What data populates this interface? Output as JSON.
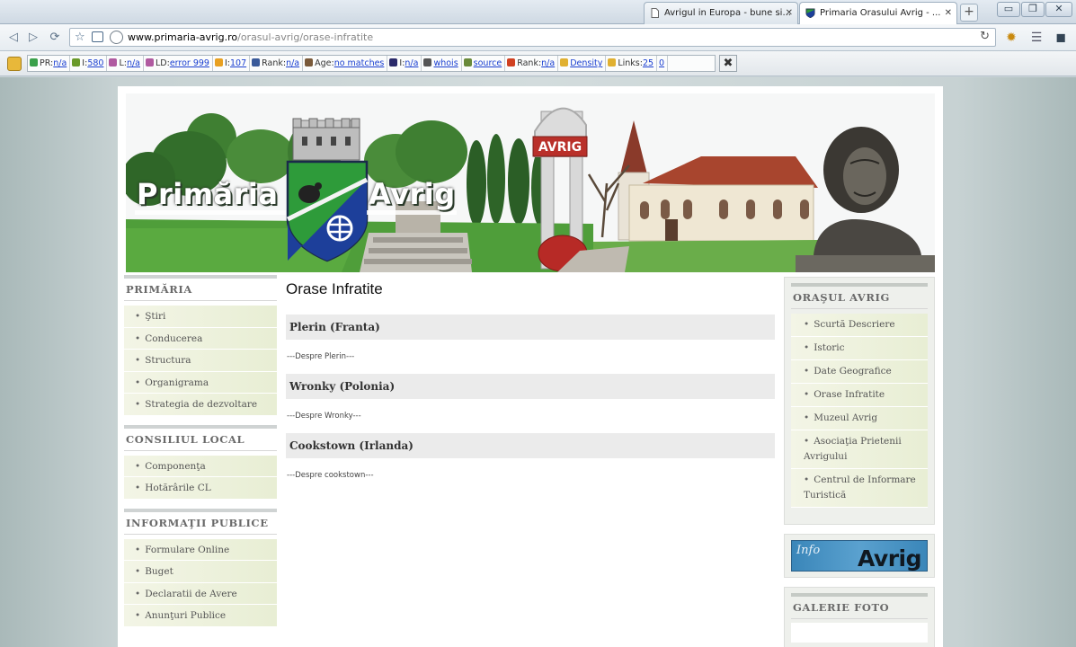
{
  "browser": {
    "tabs": [
      {
        "title": "Avrigul in Europa - bune si...",
        "active": false
      },
      {
        "title": "Primaria Orasului Avrig - ...",
        "active": true
      }
    ],
    "url_domain": "www.primaria-avrig.ro",
    "url_path": "/orasul-avrig/orase-infratite"
  },
  "seo_toolbar": {
    "items": [
      {
        "label": "PR:",
        "value": "n/a",
        "icon_color": "#3aa04a"
      },
      {
        "label": "I:",
        "value": "580",
        "icon_color": "#6a9a2a"
      },
      {
        "label": "L:",
        "value": "n/a",
        "icon_color": "#b05aa0"
      },
      {
        "label": "LD:",
        "value": "error 999",
        "icon_color": "#b05aa0"
      },
      {
        "label": "I:",
        "value": "107",
        "icon_color": "#e8a020"
      },
      {
        "label": "Rank:",
        "value": "n/a",
        "icon_color": "#3a5a9a"
      },
      {
        "label": "Age:",
        "value": "no matches",
        "icon_color": "#7a5a3a"
      },
      {
        "label": "I:",
        "value": "n/a",
        "icon_color": "#2a2a6a"
      },
      {
        "label": "",
        "value": "whois",
        "icon_color": "#555555"
      },
      {
        "label": "",
        "value": "source",
        "icon_color": "#6a8a3a"
      },
      {
        "label": "Rank:",
        "value": "n/a",
        "icon_color": "#d04020"
      },
      {
        "label": "",
        "value": "Density",
        "icon_color": "#e0b030"
      },
      {
        "label": "Links:",
        "value": "25",
        "icon_color": "#e0b030"
      },
      {
        "label": "",
        "value": "0",
        "icon_color": ""
      }
    ]
  },
  "banner": {
    "title_left": "Primăria",
    "title_right": "Avrig",
    "sign_text": "AVRIG",
    "colors": {
      "shield_green": "#2e9b3a",
      "shield_blue": "#1d3f9a",
      "grass": "#4f9e3a"
    }
  },
  "left_sidebar": {
    "sections": [
      {
        "title": "PRIMĂRIA",
        "items": [
          "Ştiri",
          "Conducerea",
          "Structura",
          "Organigrama",
          "Strategia de dezvoltare"
        ]
      },
      {
        "title": "CONSILIUL LOCAL",
        "items": [
          "Componenţa",
          "Hotărârile CL"
        ]
      },
      {
        "title": "INFORMAŢII PUBLICE",
        "items": [
          "Formulare Online",
          "Buget",
          "Declaratii de Avere",
          "Anunţuri Publice"
        ]
      }
    ]
  },
  "main": {
    "page_title": "Orase Infratite",
    "cities": [
      {
        "name": "Plerin (Franta)",
        "desc": "---Despre Plerin---"
      },
      {
        "name": "Wronky (Polonia)",
        "desc": "---Despre Wronky---"
      },
      {
        "name": "Cookstown (Irlanda)",
        "desc": "---Despre cookstown---"
      }
    ]
  },
  "right_sidebar": {
    "orasul_title": "ORAŞUL AVRIG",
    "orasul_items": [
      "Scurtă Descriere",
      "Istoric",
      "Date Geografice",
      "Orase Infratite",
      "Muzeul Avrig",
      "Asociaţia Prietenii Avrigului",
      "Centrul de Informare Turistică"
    ],
    "avrig_banner": {
      "sub": "Info",
      "big": "Avrig"
    },
    "galerie_title": "GALERIE FOTO"
  }
}
